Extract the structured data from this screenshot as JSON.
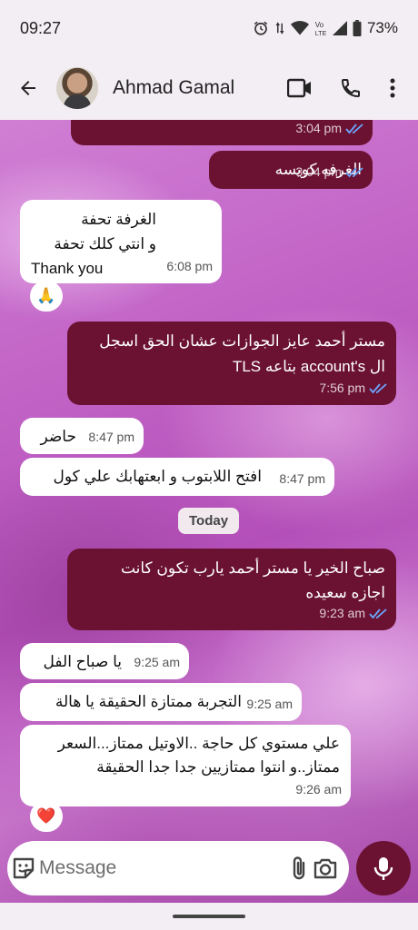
{
  "status_bar": {
    "time": "09:27",
    "battery": "73%",
    "icons": [
      "alarm-icon",
      "data-arrows-icon",
      "wifi-icon",
      "volte-icon",
      "signal-icon",
      "battery-icon"
    ]
  },
  "header": {
    "contact_name": "Ahmad Gamal",
    "actions": [
      "video-call-icon",
      "phone-icon",
      "more-vert-icon"
    ]
  },
  "messages": [
    {
      "dir": "out",
      "lines": [],
      "time": "3:04 pm",
      "read": true
    },
    {
      "dir": "out",
      "lines": [
        "الغرفه كويسه"
      ],
      "time": "3:04 pm",
      "read": true
    },
    {
      "dir": "in",
      "lines": [
        "الغرفة تحفة",
        "و انتي كلك تحفة",
        "Thank you"
      ],
      "time": "6:08 pm",
      "reaction": "🙏"
    },
    {
      "dir": "out",
      "lines": [
        "مستر أحمد عايز الجوازات عشان الحق اسجل",
        "ال account's بتاعه TLS"
      ],
      "time": "7:56 pm",
      "read": true
    },
    {
      "dir": "in",
      "lines": [
        "حاضر"
      ],
      "time": "8:47 pm"
    },
    {
      "dir": "in",
      "lines": [
        "افتح اللابتوب و ابعتهابك علي كول"
      ],
      "time": "8:47 pm"
    },
    {
      "dir": "out",
      "lines": [
        "صباح الخير يا مستر أحمد يارب تكون كانت",
        "اجازه سعيده"
      ],
      "time": "9:23 am",
      "read": true
    },
    {
      "dir": "in",
      "lines": [
        "يا صباح الفل"
      ],
      "time": "9:25 am"
    },
    {
      "dir": "in",
      "lines": [
        "التجربة ممتازة الحقيقة يا هالة"
      ],
      "time": "9:25 am"
    },
    {
      "dir": "in",
      "lines": [
        "علي مستوي كل حاجة ..الاوتيل ممتاز...السعر",
        "ممتاز..و انتوا ممتازيين جدا جدا الحقيقة"
      ],
      "time": "9:26 am",
      "reaction": "❤️"
    }
  ],
  "date_divider": "Today",
  "composer": {
    "placeholder": "Message",
    "icons": [
      "sticker-icon",
      "attach-icon",
      "camera-icon",
      "mic-icon"
    ]
  },
  "colors": {
    "outgoing_bubble": "#6b1232",
    "incoming_bubble": "#ffffff",
    "read_ticks": "#6aa8ff",
    "header_bg": "#f3eef3"
  }
}
